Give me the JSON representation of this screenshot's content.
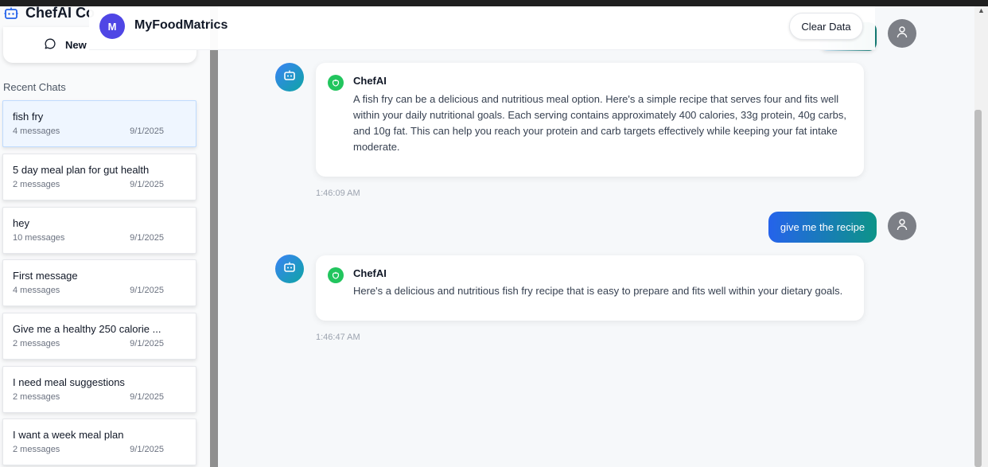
{
  "sidebar": {
    "app_title": "ChefAI Co",
    "new_chat_label": "New",
    "recent_label": "Recent Chats",
    "chats": [
      {
        "title": "fish fry",
        "count": "4 messages",
        "date": "9/1/2025"
      },
      {
        "title": "5 day meal plan for gut health",
        "count": "2 messages",
        "date": "9/1/2025"
      },
      {
        "title": "hey",
        "count": "10 messages",
        "date": "9/1/2025"
      },
      {
        "title": "First message",
        "count": "4 messages",
        "date": "9/1/2025"
      },
      {
        "title": "Give me a healthy 250 calorie ...",
        "count": "2 messages",
        "date": "9/1/2025"
      },
      {
        "title": "I need meal suggestions",
        "count": "2 messages",
        "date": "9/1/2025"
      },
      {
        "title": "I want a week meal plan",
        "count": "2 messages",
        "date": "9/1/2025"
      }
    ]
  },
  "header": {
    "avatar_letter": "M",
    "brand": "MyFoodMatrics",
    "clear_label": "Clear Data"
  },
  "messages": [
    {
      "sender": "ChefAI",
      "text": "A fish fry can be a delicious and nutritious meal option. Here's a simple recipe that serves four and fits well within your daily nutritional goals. Each serving contains approximately 400 calories, 33g protein, 40g carbs, and 10g fat. This can help you reach your protein and carb targets effectively while keeping your fat intake moderate.",
      "time": "1:46:09 AM"
    },
    {
      "user_text": "give me the recipe"
    },
    {
      "sender": "ChefAI",
      "text": "Here's a delicious and nutritious fish fry recipe that is easy to prepare and fits well within your dietary goals.",
      "time": "1:46:47 AM"
    }
  ],
  "icons": {
    "bot": "robot-icon",
    "leaf": "apple-icon",
    "user": "user-icon",
    "chat": "message-circle-icon"
  },
  "colors": {
    "brand_avatar": "#4f46e5",
    "bot_gradient_start": "#3b82f6",
    "bot_gradient_end": "#0ea5a4",
    "assistant_badge": "#22c55e",
    "user_bubble_start": "#2563eb",
    "user_bubble_end": "#0d9488"
  }
}
